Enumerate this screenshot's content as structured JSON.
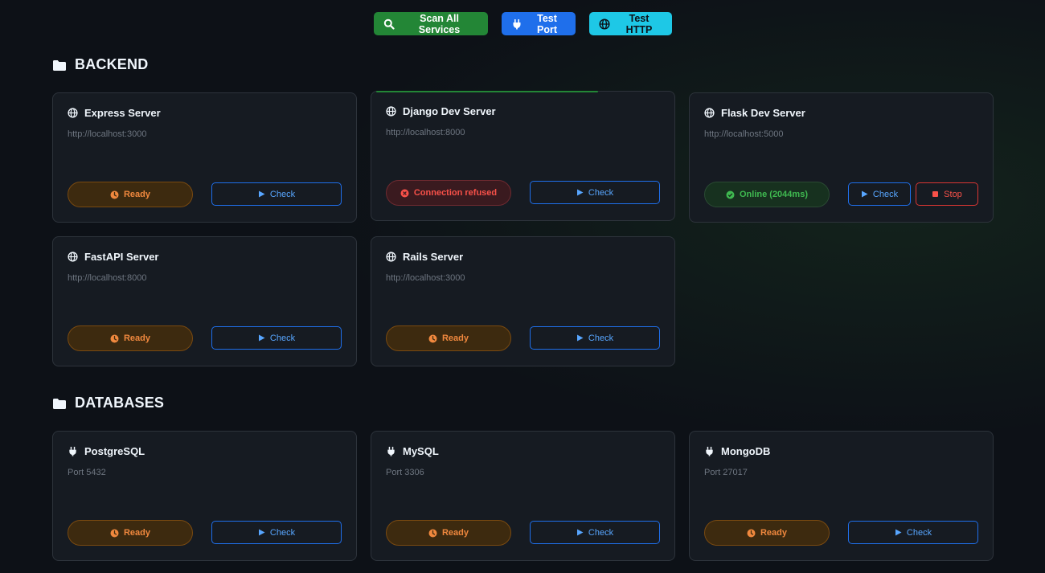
{
  "toolbar": {
    "scan_label": "Scan All Services",
    "port_label": "Test Port",
    "http_label": "Test HTTP"
  },
  "sections": {
    "backend": {
      "title": "BACKEND",
      "services": [
        {
          "name": "Express Server",
          "url": "http://localhost:3000",
          "status": "Ready",
          "check": "Check"
        },
        {
          "name": "Django Dev Server",
          "url": "http://localhost:8000",
          "status": "Connection refused",
          "check": "Check"
        },
        {
          "name": "Flask Dev Server",
          "url": "http://localhost:5000",
          "status": "Online (2044ms)",
          "check": "Check",
          "stop": "Stop"
        },
        {
          "name": "FastAPI Server",
          "url": "http://localhost:8000",
          "status": "Ready",
          "check": "Check"
        },
        {
          "name": "Rails Server",
          "url": "http://localhost:3000",
          "status": "Ready",
          "check": "Check"
        }
      ]
    },
    "databases": {
      "title": "DATABASES",
      "services": [
        {
          "name": "PostgreSQL",
          "url": "Port 5432",
          "status": "Ready",
          "check": "Check"
        },
        {
          "name": "MySQL",
          "url": "Port 3306",
          "status": "Ready",
          "check": "Check"
        },
        {
          "name": "MongoDB",
          "url": "Port 27017",
          "status": "Ready",
          "check": "Check"
        }
      ]
    }
  },
  "colors": {
    "background": "#0d1117",
    "card": "#161b22",
    "success": "#238636",
    "accent": "#1f6feb",
    "cyan": "#1ec8e6",
    "warning": "#f0883e",
    "danger": "#f85149"
  },
  "icons": {
    "scan": "search-icon",
    "port": "plug-icon",
    "http": "globe-icon",
    "section": "folder-icon",
    "ready": "clock-icon",
    "refused": "x-circle-icon",
    "online": "check-circle-icon",
    "check": "play-icon",
    "stop": "stop-icon"
  }
}
